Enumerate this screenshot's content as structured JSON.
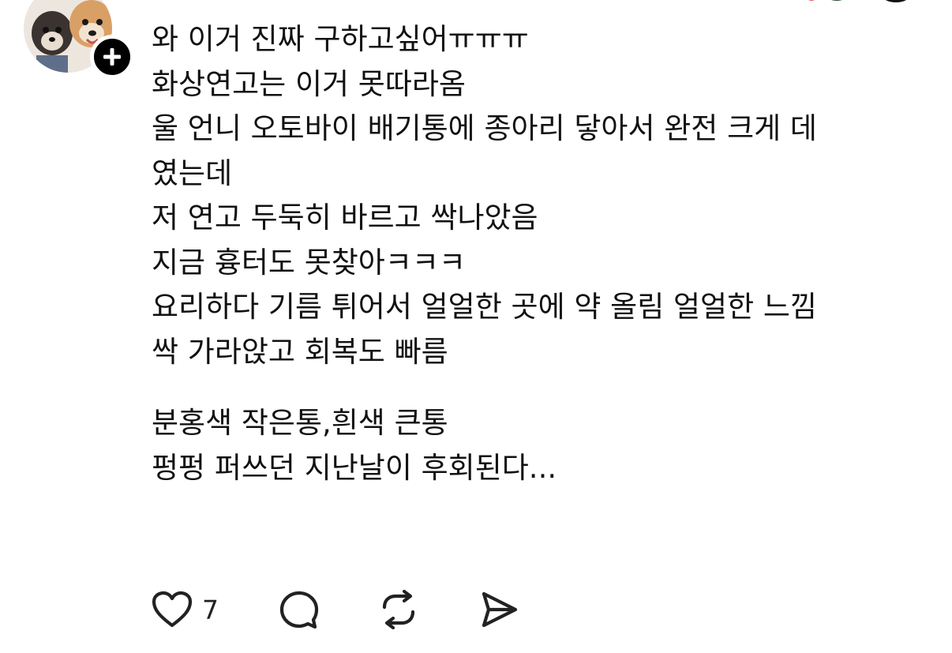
{
  "post": {
    "lines": [
      "와 이거 진짜 구하고싶어ㅠㅠㅠ",
      "화상연고는 이거 못따라옴",
      "울 언니  오토바이 배기통에 종아리 닿아서 완전 크게 데",
      "였는데",
      "저 연고 두둑히 바르고 싹나았음",
      "지금 흉터도 못찾아ㅋㅋㅋ",
      "요리하다 기름 튀어서 얼얼한 곳에 약  올림 얼얼한 느낌",
      "싹 가라앉고 회복도 빠름",
      "분홍색 작은통,흰색 큰통",
      "펑펑 퍼쓰던 지난날이 후회된다..."
    ]
  },
  "actions": {
    "like_icon": "heart-icon",
    "like_count": "7",
    "reply_icon": "comment-icon",
    "repost_icon": "repost-icon",
    "share_icon": "send-icon"
  },
  "avatar": {
    "follow_icon": "plus-icon"
  },
  "colors": {
    "text": "#111111",
    "icon": "#222222",
    "follow_button": "#000000"
  }
}
